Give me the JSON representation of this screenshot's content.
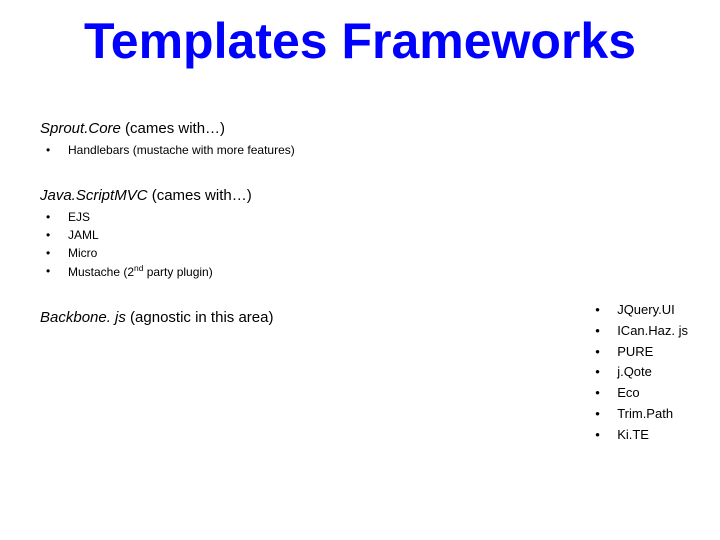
{
  "title": "Templates Frameworks",
  "sections": [
    {
      "name": "Sprout.Core",
      "suffix": " (cames with…)",
      "items": [
        "Handlebars (mustache with more features)"
      ]
    },
    {
      "name": "Java.ScriptMVC",
      "suffix": " (cames with…)",
      "items": [
        "EJS",
        "JAML",
        "Micro",
        "Mustache (2__SUP__nd__/SUP__ party plugin)"
      ]
    }
  ],
  "standalone": {
    "name": "Backbone. js",
    "suffix": " (agnostic in this area)"
  },
  "rightList": [
    "JQuery.UI",
    "ICan.Haz. js",
    "PURE",
    "j.Qote",
    "Eco",
    "Trim.Path",
    "Ki.TE"
  ]
}
